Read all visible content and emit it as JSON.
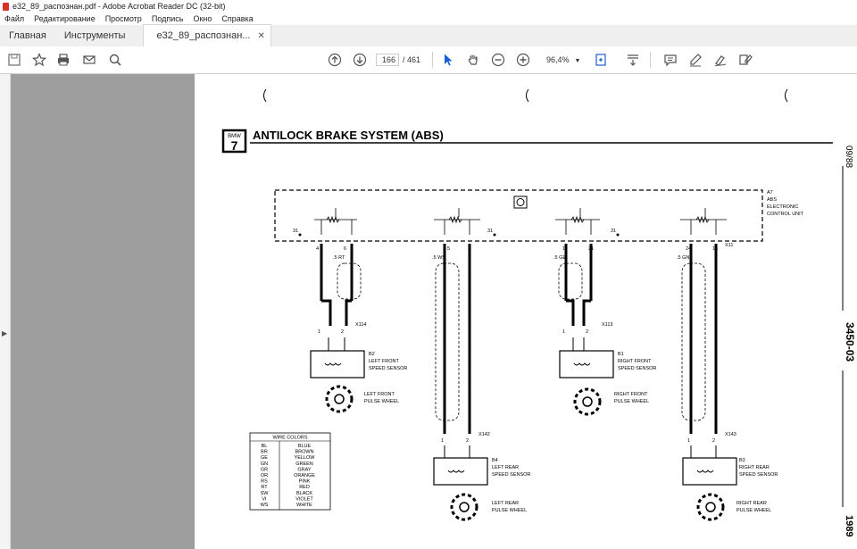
{
  "window": {
    "title": "e32_89_распознан.pdf - Adobe Acrobat Reader DC (32-bit)"
  },
  "menu": [
    "Файл",
    "Редактирование",
    "Просмотр",
    "Подпись",
    "Окно",
    "Справка"
  ],
  "tabs": {
    "home": "Главная",
    "tools": "Инструменты",
    "doc": "e32_89_распознан..."
  },
  "toolbar": {
    "page_current": "166",
    "page_total": "/ 461",
    "zoom": "96,4%"
  },
  "doc": {
    "logo_text": "BMW",
    "logo_num": "7",
    "title": "ANTILOCK BRAKE SYSTEM (ABS)",
    "side_date": "09/88",
    "side_code": "3450-03",
    "side_year": "1989",
    "ecu": {
      "id": "A7",
      "l1": "ABS",
      "l2": "ELECTRONIC",
      "l3": "CONTROL UNIT"
    },
    "pins": {
      "p31a": "31",
      "p31b": "31",
      "p31c": "31",
      "p4": "4",
      "p6": "6",
      "p5": "5",
      "p3": "3",
      "p11": "11",
      "p21": "21",
      "p24": "24",
      "p13": "13"
    },
    "wires": {
      "w_rt": ".5 RT",
      "w_ws": ".5 WS",
      "w_ge": ".5 GE",
      "w_gn": ".5 GN",
      "x11": "X11"
    },
    "connectors": {
      "x114": "X114",
      "x113": "X113",
      "x142": "X142",
      "x143": "X143",
      "one": "1",
      "two": "2"
    },
    "sensors": {
      "lf": {
        "id": "B2",
        "l1": "LEFT FRONT",
        "l2": "SPEED SENSOR"
      },
      "rf": {
        "id": "B1",
        "l1": "RIGHT FRONT",
        "l2": "SPEED SENSOR"
      },
      "lr": {
        "id": "B4",
        "l1": "LEFT REAR",
        "l2": "SPEED SENSOR"
      },
      "rr": {
        "id": "B3",
        "l1": "RIGHT REAR",
        "l2": "SPEED SENSOR"
      }
    },
    "wheels": {
      "lf": {
        "l1": "LEFT FRONT",
        "l2": "PULSE WHEEL"
      },
      "rf": {
        "l1": "RIGHT FRONT",
        "l2": "PULSE WHEEL"
      },
      "lr": {
        "l1": "LEFT REAR",
        "l2": "PULSE WHEEL"
      },
      "rr": {
        "l1": "RIGHT REAR",
        "l2": "PULSE WHEEL"
      }
    },
    "wire_colors": {
      "title": "WIRE COLORS",
      "rows": [
        [
          "BL",
          "BLUE"
        ],
        [
          "BR",
          "BROWN"
        ],
        [
          "GE",
          "YELLOW"
        ],
        [
          "GN",
          "GREEN"
        ],
        [
          "GR",
          "GRAY"
        ],
        [
          "OR",
          "ORANGE"
        ],
        [
          "RS",
          "PINK"
        ],
        [
          "RT",
          "RED"
        ],
        [
          "SW",
          "BLACK"
        ],
        [
          "VI",
          "VIOLET"
        ],
        [
          "WS",
          "WHITE"
        ]
      ]
    }
  }
}
